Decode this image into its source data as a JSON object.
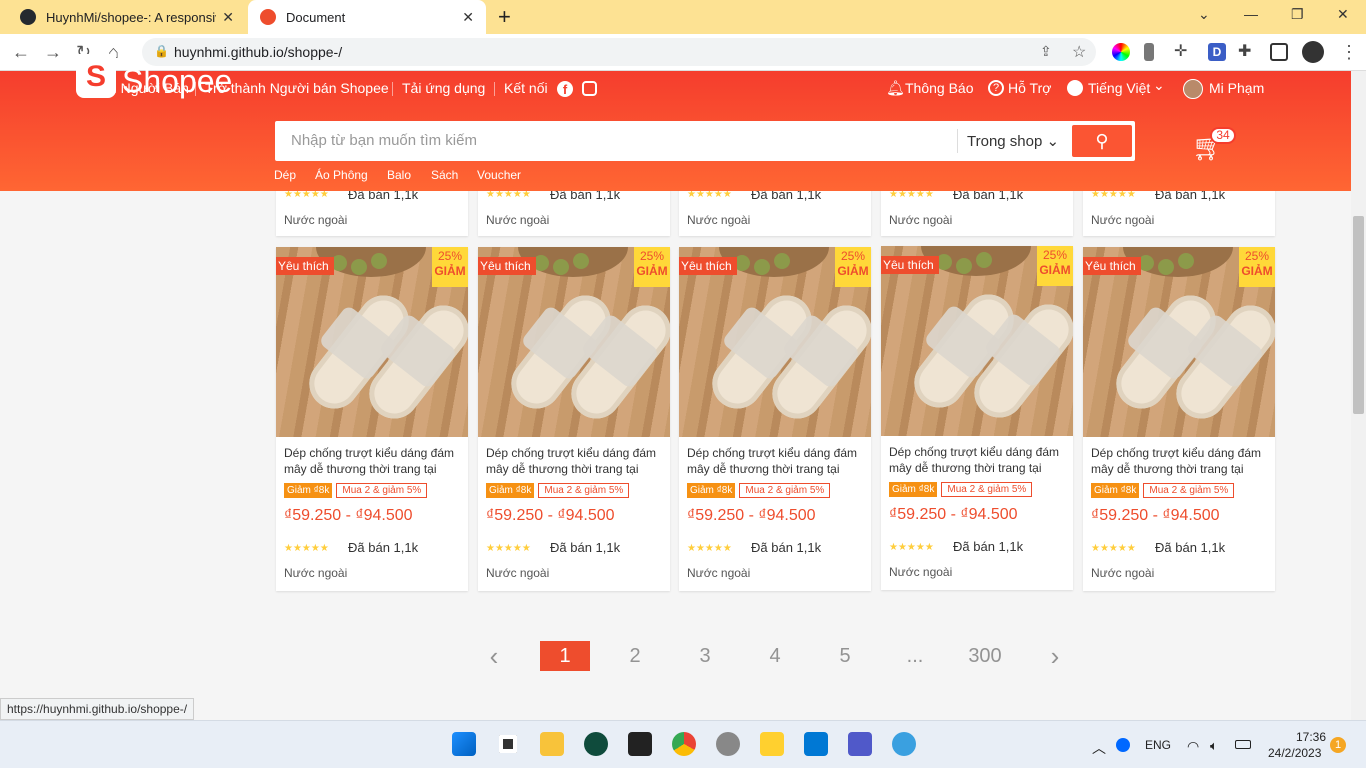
{
  "browser": {
    "tabs": [
      {
        "title": "HuynhMi/shopee-: A responsive",
        "icon": "github-icon"
      },
      {
        "title": "Document",
        "icon": "shopee-favicon-icon"
      }
    ],
    "url": "huynhmi.github.io/shoppe-/",
    "status_url": "https://huynhmi.github.io/shoppe-/"
  },
  "topbar": {
    "left": [
      "Kênh Người Bán",
      "Trở thành Người bán Shopee",
      "Tải ứng dụng",
      "Kết nối"
    ],
    "notify": "Thông Báo",
    "help": "Hỗ Trợ",
    "lang": "Tiếng Việt",
    "user": "Mi Phạm"
  },
  "header": {
    "logo": "Shopee",
    "search_placeholder": "Nhập từ bạn muốn tìm kiếm",
    "search_scope": "Trong shop",
    "cart_count": "34",
    "categories": [
      "Dép",
      "Áo Phông",
      "Balo",
      "Sách",
      "Voucher"
    ]
  },
  "top_row": {
    "sold": "Đã bán 1,1k",
    "origin": "Nước ngoài"
  },
  "products": [
    {
      "badge": "Yêu thích",
      "discount": "25%",
      "discount_label": "GIẢM",
      "name": "Dép chống trượt kiểu dáng đám mây dễ thương thời trang tại nh...",
      "tag1": "Giảm ₫8k",
      "tag2": "Mua 2 & giảm 5%",
      "price": "₫59.250 - ₫94.500",
      "rating": 4.5,
      "sold": "Đã bán 1,1k",
      "origin": "Nước ngoài"
    },
    {
      "badge": "Yêu thích",
      "discount": "25%",
      "discount_label": "GIẢM",
      "name": "Dép chống trượt kiểu dáng đám mây dễ thương thời trang tại nh...",
      "tag1": "Giảm ₫8k",
      "tag2": "Mua 2 & giảm 5%",
      "price": "₫59.250 - ₫94.500",
      "rating": 4.5,
      "sold": "Đã bán 1,1k",
      "origin": "Nước ngoài"
    },
    {
      "badge": "Yêu thích",
      "discount": "25%",
      "discount_label": "GIẢM",
      "name": "Dép chống trượt kiểu dáng đám mây dễ thương thời trang tại nh...",
      "tag1": "Giảm ₫8k",
      "tag2": "Mua 2 & giảm 5%",
      "price": "₫59.250 - ₫94.500",
      "rating": 4.5,
      "sold": "Đã bán 1,1k",
      "origin": "Nước ngoài"
    },
    {
      "badge": "Yêu thích",
      "discount": "25%",
      "discount_label": "GIẢM",
      "name": "Dép chống trượt kiểu dáng đám mây dễ thương thời trang tại nh...",
      "tag1": "Giảm ₫8k",
      "tag2": "Mua 2 & giảm 5%",
      "price": "₫59.250 - ₫94.500",
      "rating": 4.5,
      "sold": "Đã bán 1,1k",
      "origin": "Nước ngoài"
    },
    {
      "badge": "Yêu thích",
      "discount": "25%",
      "discount_label": "GIẢM",
      "name": "Dép chống trượt kiểu dáng đám mây dễ thương thời trang tại nh...",
      "tag1": "Giảm ₫8k",
      "tag2": "Mua 2 & giảm 5%",
      "price": "₫59.250 - ₫94.500",
      "rating": 4.5,
      "sold": "Đã bán 1,1k",
      "origin": "Nước ngoài"
    }
  ],
  "pagination": {
    "prev": "‹",
    "pages": [
      "1",
      "2",
      "3",
      "4",
      "5",
      "...",
      "300"
    ],
    "active": "1",
    "next": "›"
  },
  "taskbar": {
    "lang": "ENG",
    "time": "17:36",
    "date": "24/2/2023",
    "notifications": "1"
  }
}
